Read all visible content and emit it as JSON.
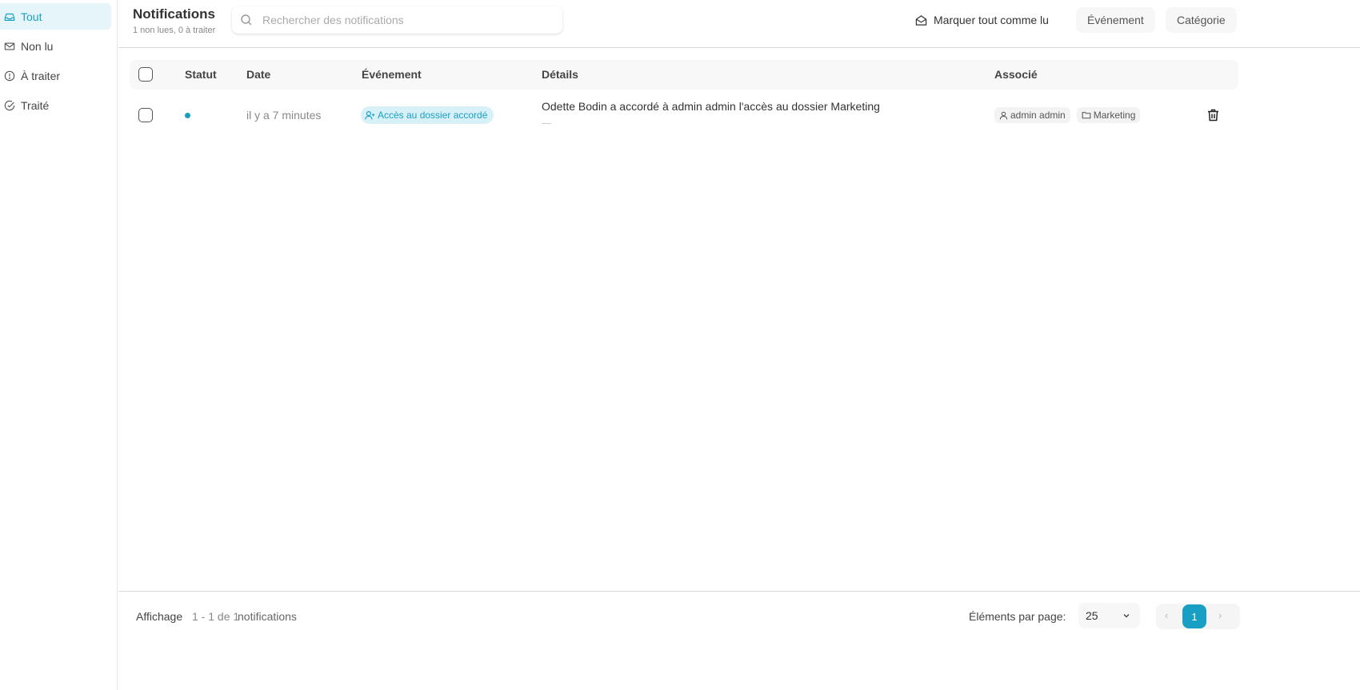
{
  "sidebar": {
    "items": [
      {
        "label": "Tout",
        "icon": "inbox-icon",
        "active": true
      },
      {
        "label": "Non lu",
        "icon": "mail-icon",
        "active": false
      },
      {
        "label": "À traiter",
        "icon": "alert-circle-icon",
        "active": false
      },
      {
        "label": "Traité",
        "icon": "check-circle-icon",
        "active": false
      }
    ]
  },
  "header": {
    "title": "Notifications",
    "subtitle": "1 non lues, 0 à traiter",
    "search_placeholder": "Rechercher des notifications",
    "mark_all_label": "Marquer tout comme lu",
    "filter_event_label": "Événement",
    "filter_category_label": "Catégorie"
  },
  "table": {
    "columns": {
      "status": "Statut",
      "date": "Date",
      "event": "Événement",
      "details": "Détails",
      "associated": "Associé"
    },
    "rows": [
      {
        "status": "unread",
        "date": "il y a 7 minutes",
        "event": "Accès au dossier accordé",
        "details": "Odette Bodin a accordé à admin admin l'accès au dossier Marketing",
        "associated_user": "admin admin",
        "associated_folder": "Marketing"
      }
    ]
  },
  "footer": {
    "showing_label": "Affichage",
    "range": "1 - 1 de 1",
    "unit": "notifications",
    "per_page_label": "Éléments par page:",
    "per_page_value": "25",
    "current_page": "1",
    "prev_symbol": "‹",
    "next_symbol": "›"
  },
  "colors": {
    "accent": "#1a9fc4",
    "accent_light": "#e6f5fa"
  }
}
